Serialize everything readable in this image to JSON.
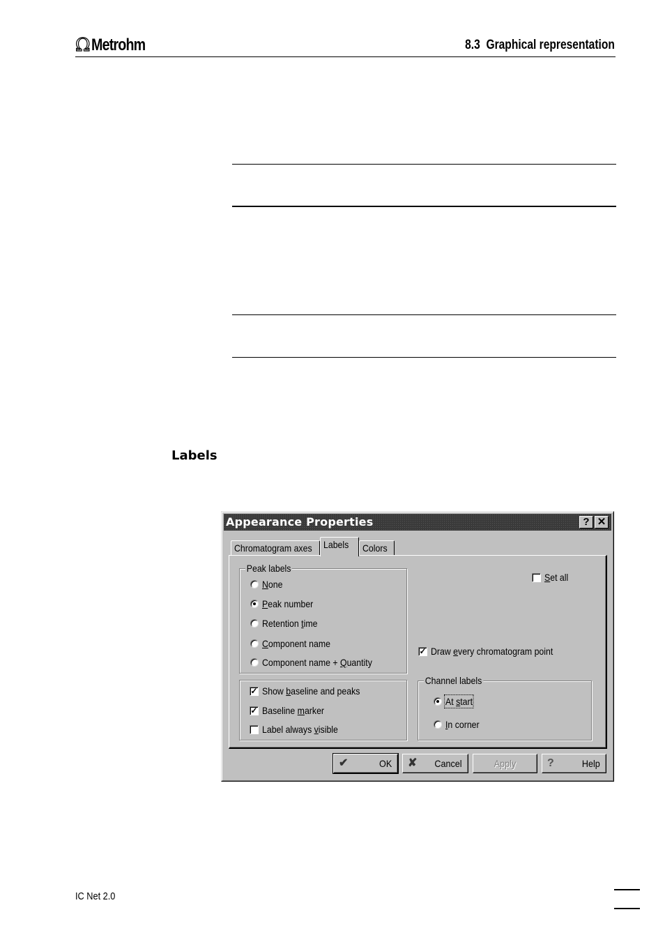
{
  "page_header": {
    "logo_symbol": "Ω",
    "logo_text": "Metrohm",
    "section_title": "8.3  Graphical representation"
  },
  "side_heading": "Labels",
  "footer": {
    "product": "IC Net 2.0"
  },
  "dialog": {
    "title": "Appearance Properties",
    "title_buttons": {
      "help": "?",
      "close": "✕"
    },
    "tabs": [
      {
        "label": "Chromatogram axes",
        "active": false
      },
      {
        "label": "Labels",
        "active": true
      },
      {
        "label": "Colors",
        "active": false
      }
    ],
    "peak_labels": {
      "legend": "Peak labels",
      "selected": "Peak number",
      "options": [
        {
          "pre": "",
          "key": "N",
          "post": "one",
          "selected": false
        },
        {
          "pre": "",
          "key": "P",
          "post": "eak number",
          "selected": true
        },
        {
          "pre": "Retention ",
          "key": "t",
          "post": "ime",
          "selected": false
        },
        {
          "pre": "",
          "key": "C",
          "post": "omponent name",
          "selected": false
        },
        {
          "pre": "Component name + ",
          "key": "Q",
          "post": "uantity",
          "selected": false
        }
      ]
    },
    "display_options": [
      {
        "pre": "Show ",
        "key": "b",
        "post": "aseline and peaks",
        "checked": true
      },
      {
        "pre": "Baseline ",
        "key": "m",
        "post": "arker",
        "checked": true
      },
      {
        "pre": "Label always ",
        "key": "v",
        "post": "isible",
        "checked": false
      }
    ],
    "set_all": {
      "pre": "",
      "key": "S",
      "post": "et all",
      "checked": false
    },
    "draw_every_point": {
      "pre": "Draw ",
      "key": "e",
      "post": "very chromatogram point",
      "checked": true
    },
    "channel_labels": {
      "legend": "Channel labels",
      "selected": "At start",
      "options": [
        {
          "pre": "At ",
          "key": "s",
          "post": "tart",
          "selected": true
        },
        {
          "pre": "",
          "key": "I",
          "post": "n corner",
          "selected": false
        }
      ]
    },
    "buttons": {
      "ok": {
        "icon": "✔",
        "label": "OK"
      },
      "cancel": {
        "icon": "✘",
        "label": "Cancel"
      },
      "apply": {
        "label": "Apply",
        "enabled": false
      },
      "help": {
        "icon": "?",
        "label": "Help"
      }
    }
  }
}
